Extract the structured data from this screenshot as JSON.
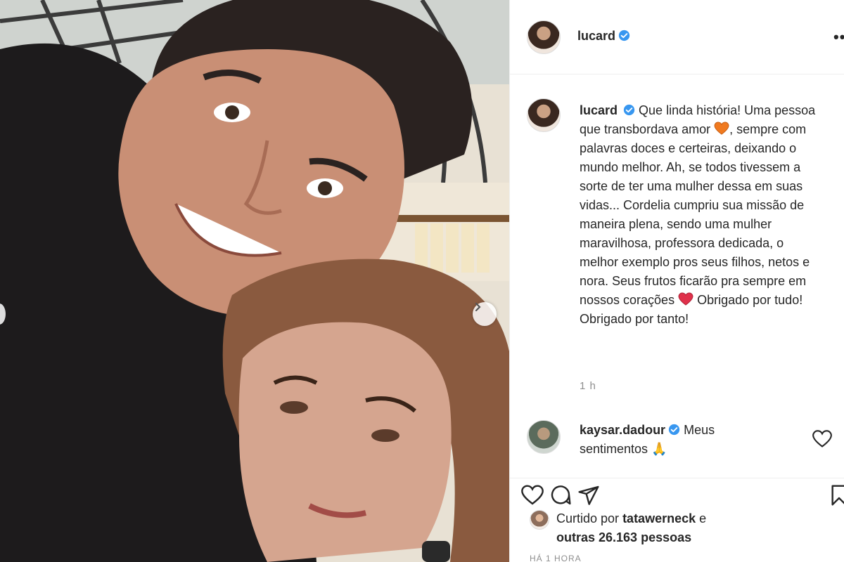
{
  "post": {
    "username": "lucard",
    "verified": true
  },
  "caption": {
    "username": "lucard",
    "text_part1": "Que linda história! Uma pessoa que transbordava amor",
    "text_part2": ", sempre com palavras doces e certeiras, deixando o mundo melhor. Ah, se todos tivessem a sorte de ter uma mulher dessa em suas vidas... Cordelia cumpriu sua missão de maneira plena, sendo uma mulher maravilhosa, professora dedicada, o melhor exemplo pros seus filhos, netos e nora. Seus frutos ficarão pra sempre em nossos corações",
    "text_part3": "Obrigado por tudo! Obrigado por tanto!",
    "time_ago": "1 h"
  },
  "comment": {
    "username": "kaysar.dadour",
    "text": "Meus sentimentos",
    "emoji": "🙏"
  },
  "likes": {
    "prefix": "Curtido por",
    "liker": "tatawerneck",
    "conjunction": "e",
    "others": "outras 26.163 pessoas"
  },
  "posted": "HÁ 1 HORA",
  "icons": {
    "header_more": "more-horizontal-icon",
    "verified": "verified-badge-icon",
    "like": "heart-icon",
    "comment": "comment-icon",
    "share": "send-icon",
    "save": "bookmark-icon",
    "carousel_next": "chevron-right-icon"
  },
  "colors": {
    "verified_blue": "#3897f0",
    "text": "#262626",
    "muted": "#8e8e8e",
    "border": "#efefef",
    "heart_orange": "#f07a1f",
    "heart_red": "#e0314b"
  }
}
